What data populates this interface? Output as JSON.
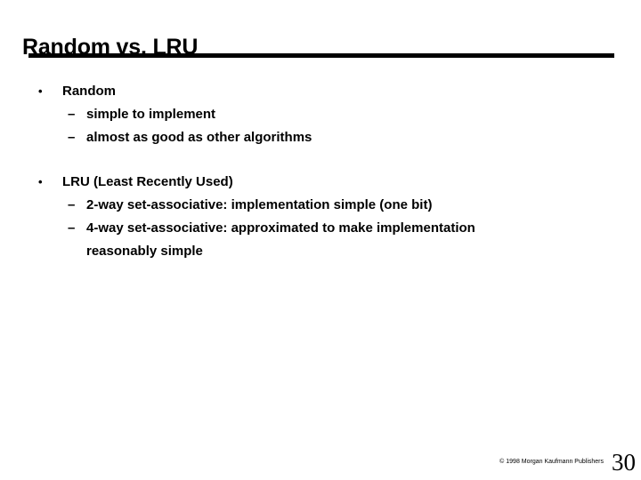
{
  "slide": {
    "title": "Random vs. LRU",
    "bullet_marker_level1": "•",
    "bullet_marker_level2": "–",
    "groups": [
      {
        "heading": "Random",
        "sub_items": [
          {
            "text": "simple to implement"
          },
          {
            "text": "almost as good as other algorithms"
          }
        ]
      },
      {
        "heading": "LRU (Least Recently Used)",
        "sub_items": [
          {
            "text": "2-way set-associative: implementation simple (one bit)"
          },
          {
            "text": "4-way set-associative: approximated to make implementation",
            "wrap_text": "reasonably simple"
          }
        ]
      }
    ]
  },
  "footer": {
    "copyright": "© 1998 Morgan Kaufmann Publishers",
    "page_number": "30"
  },
  "colors": {
    "background": "#ffffff",
    "text": "#000000",
    "rule": "#000000"
  }
}
